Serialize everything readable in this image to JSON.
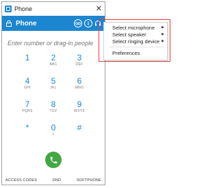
{
  "window": {
    "title": "Phone",
    "close_glyph": "✕"
  },
  "header": {
    "title": "Phone",
    "icons": [
      "voicemail-icon",
      "info-icon",
      "headset-icon"
    ]
  },
  "search": {
    "placeholder": "Enter number or drag-in people"
  },
  "keypad": {
    "keys": [
      {
        "num": "1",
        "letters": ""
      },
      {
        "num": "2",
        "letters": "ABC"
      },
      {
        "num": "3",
        "letters": "DEF"
      },
      {
        "num": "4",
        "letters": "GHI"
      },
      {
        "num": "5",
        "letters": "JKL"
      },
      {
        "num": "6",
        "letters": "MNO"
      },
      {
        "num": "7",
        "letters": "PQRS"
      },
      {
        "num": "8",
        "letters": "TUV"
      },
      {
        "num": "9",
        "letters": "WXYZ"
      },
      {
        "num": "*",
        "letters": ""
      },
      {
        "num": "0",
        "letters": "+"
      },
      {
        "num": "#",
        "letters": ""
      }
    ]
  },
  "footer": {
    "access_codes": "ACCESS CODES",
    "dnd": "DND",
    "softphone": "SOFTPHONE"
  },
  "menu": {
    "items": [
      {
        "label": "Select microphone",
        "submenu": true
      },
      {
        "label": "Select speaker",
        "submenu": true
      },
      {
        "label": "Select ringing device",
        "submenu": true
      },
      {
        "label": "Preferences",
        "submenu": false
      }
    ]
  },
  "colors": {
    "accent": "#1c86d1",
    "call": "#43a843",
    "highlight": "#e03c3c"
  }
}
